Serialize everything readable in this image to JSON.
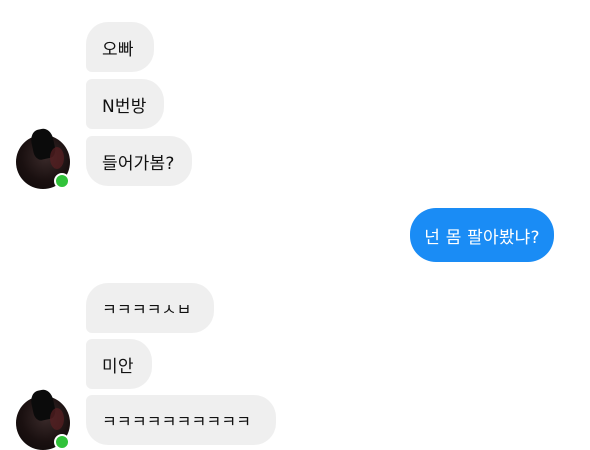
{
  "messages": {
    "incoming_group_1": [
      "오빠",
      "N번방",
      "들어가봄?"
    ],
    "outgoing_1": "넌 몸 팔아봤냐?",
    "incoming_group_2": [
      "ㅋㅋㅋㅋㅅㅂ",
      "미안",
      "ㅋㅋㅋㅋㅋㅋㅋㅋㅋㅋ"
    ]
  },
  "colors": {
    "incoming_bubble": "#efefef",
    "outgoing_bubble": "#1a8cf5",
    "online_dot": "#31c23a"
  },
  "icons": {
    "avatar": "contact-avatar",
    "online": "online-status-dot"
  }
}
